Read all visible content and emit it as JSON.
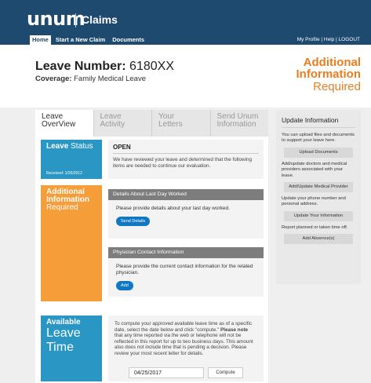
{
  "header": {
    "logo": "unum",
    "app_name": "Claims",
    "nav": [
      "Home",
      "Start a New Claim",
      "Documents"
    ],
    "util_links": "My Profile | Help | LOGOUT"
  },
  "leave": {
    "number_label": "Leave Number:",
    "number": "6180XX",
    "coverage_label": "Coverage:",
    "coverage": "Family Medical Leave"
  },
  "alert": {
    "line1": "Additional",
    "line2": "Information",
    "line3": "Required"
  },
  "tabs": [
    {
      "line1": "Leave",
      "line2": "OverView"
    },
    {
      "line1": "Leave",
      "line2": "Activity"
    },
    {
      "line1": "Your",
      "line2": "Letters"
    },
    {
      "line1": "Send Unum",
      "line2": "Information"
    }
  ],
  "status": {
    "heading_bold": "Leave",
    "heading_rest": "Status",
    "received": "Received: 1/26/2012",
    "state": "OPEN",
    "message": "We have reviewed your leave and determined that the following items are needed to continue our evaluation."
  },
  "additional": {
    "line1": "Additional",
    "line2": "Information",
    "line3": "Required",
    "cards": [
      {
        "title": "Details About Last Day Worked",
        "body": "Please provide details about your last day worked.",
        "button": "Send Details"
      },
      {
        "title": "Physician Contact Information",
        "body": "Please provide the current contact information for the related physician.",
        "button": "Add"
      }
    ]
  },
  "available": {
    "line1": "Available",
    "line2": "Leave Time",
    "text_a": "To compute your ",
    "text_em": "approved",
    "text_b": " available leave time as of a specific date, select the date below and click \"compute.\" ",
    "note_bold": "Please note",
    "text_c": " that any time reported via the web or telephone will not be reflected in this report for up to two business days. This amount also does not include time that is pending a decision. Please review your most recent letter for details.",
    "date_value": "04/25/2017",
    "compute": "Compute"
  },
  "right_panel": {
    "title": "Update Information",
    "sections": [
      {
        "text": "You can upload files and documents to support your leave here.",
        "button": "Upload Documents"
      },
      {
        "text": "Add/update doctors and medical providers associated with your leave.",
        "button": "Add/Update Medical Provider"
      },
      {
        "text": "Update your phone number and personal address.",
        "button": "Update Your Information"
      },
      {
        "text": "Report planned or taken time off.",
        "button": "Add Absence(s)"
      }
    ]
  },
  "colors": {
    "header_bg": "#1d4a6e",
    "status_blue": "#2a96c3",
    "alert_orange": "#f59d39",
    "action_blue": "#0f78c1"
  }
}
